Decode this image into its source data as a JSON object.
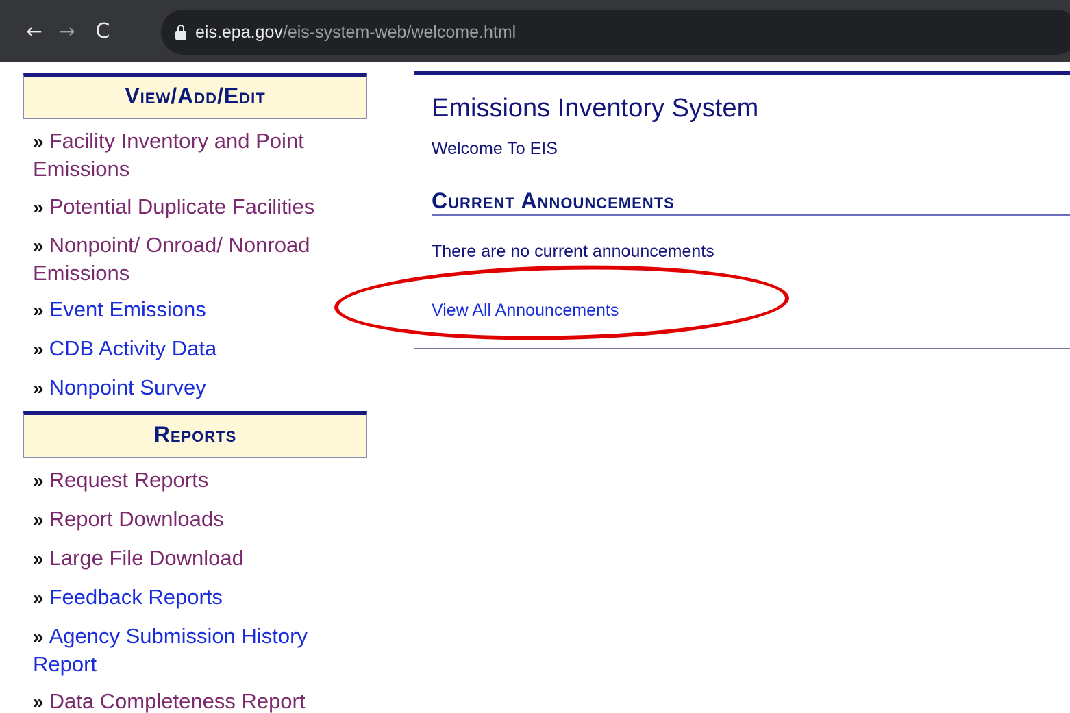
{
  "browser": {
    "back_icon": "←",
    "forward_icon": "→",
    "reload_icon": "C",
    "url_domain": "eis.epa.gov",
    "url_path": "/eis-system-web/welcome.html"
  },
  "sidebar": {
    "view_add_edit": {
      "heading": "View/Add/Edit",
      "links": [
        {
          "label": "Facility Inventory and Point Emissions",
          "visited": true
        },
        {
          "label": "Potential Duplicate Facilities",
          "visited": true
        },
        {
          "label": "Nonpoint/ Onroad/ Nonroad Emissions",
          "visited": true
        },
        {
          "label": "Event Emissions",
          "visited": false
        },
        {
          "label": "CDB Activity Data",
          "visited": false
        },
        {
          "label": "Nonpoint Survey",
          "visited": false
        }
      ]
    },
    "reports": {
      "heading": "Reports",
      "links": [
        {
          "label": "Request Reports",
          "visited": true
        },
        {
          "label": "Report Downloads",
          "visited": true
        },
        {
          "label": "Large File Download",
          "visited": true
        },
        {
          "label": "Feedback Reports",
          "visited": false
        },
        {
          "label": "Agency Submission History Report",
          "visited": false
        },
        {
          "label": "Data Completeness Report",
          "visited": true
        }
      ]
    },
    "bullet": "»"
  },
  "main": {
    "title": "Emissions Inventory System",
    "welcome": "Welcome To EIS",
    "announcements_heading": "Current Announcements",
    "no_announcements": "There are no current announcements",
    "view_all_link": "View All Announcements"
  },
  "colors": {
    "header_bg": "#fff8d8",
    "header_border": "#1a1a80",
    "visited_link": "#7b2a6e",
    "link": "#1a2ddb",
    "annotation": "#e00000"
  }
}
